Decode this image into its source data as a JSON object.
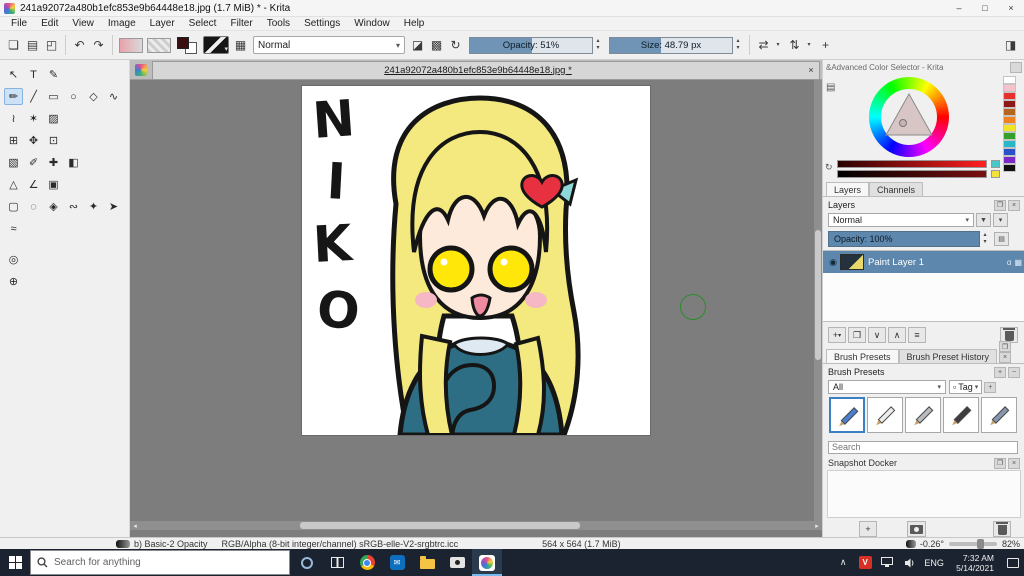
{
  "window": {
    "title": "241a92072a480b1efc853e9b64448e18.jpg (1.7 MiB) * - Krita"
  },
  "menu": {
    "items": [
      "File",
      "Edit",
      "View",
      "Image",
      "Layer",
      "Select",
      "Filter",
      "Tools",
      "Settings",
      "Window",
      "Help"
    ]
  },
  "toolbar": {
    "blend_mode": "Normal",
    "opacity_label": "Opacity: 51%",
    "size_label": "Size: 48.79 px"
  },
  "canvas": {
    "tab_title": "241a92072a480b1efc853e9b64448e18.jpg *",
    "artwork": {
      "letters": [
        "N",
        "I",
        "K",
        "O"
      ],
      "colors": {
        "hair": "#f3e97e",
        "skin": "#fdeada",
        "eyes": "#ffe70a",
        "blush": "#f5b8c4",
        "mouth": "#ef8aa0",
        "sweater": "#2e6e84",
        "heart": "#e73141",
        "bow": "#8fd8da",
        "collar": "#dfe9f2",
        "outline": "#151515"
      }
    }
  },
  "color_docker": {
    "title": "&Advanced Color Selector - Krita",
    "swatches": [
      "#ffffff",
      "#f6c2cc",
      "#e63030",
      "#8c1818",
      "#b5651d",
      "#f08020",
      "#f2e22a",
      "#33a02c",
      "#2ab8c8",
      "#2a52c8",
      "#7a2ac8",
      "#101010"
    ],
    "recent": [
      "#46c8c8",
      "#f2e23a"
    ]
  },
  "layers_docker": {
    "tab_layers": "Layers",
    "tab_channels": "Channels",
    "title": "Layers",
    "blend_mode": "Normal",
    "opacity_label": "Opacity:  100%",
    "layer_name": "Paint Layer 1"
  },
  "brush_docker": {
    "tab_presets": "Brush Presets",
    "tab_history": "Brush Preset History",
    "section_label": "Brush Presets",
    "filter_value": "All",
    "tag_label": "Tag",
    "search_placeholder": "Search",
    "preset_colors": [
      "#4a7fd0",
      "#ececec",
      "#b8bcc0",
      "#3c3c3c",
      "#8696ac"
    ]
  },
  "snapshot_docker": {
    "title": "Snapshot Docker"
  },
  "status_bar": {
    "brush_name": "b) Basic-2 Opacity",
    "color_profile": "RGB/Alpha (8-bit integer/channel)  sRGB-elle-V2-srgbtrc.icc",
    "doc_size": "564 x 564 (1.7 MiB)",
    "rotation": "-0.26°",
    "zoom": "82%"
  },
  "taskbar": {
    "search_placeholder": "Search for anything",
    "language": "ENG",
    "time": "7:32 AM",
    "date": "5/14/2021"
  },
  "colors": {
    "accent": "#5d87ac",
    "toolbar_slider_fill": "#6f94b5",
    "canvas_bg": "#7d7d7d",
    "taskbar_bg": "#1c2330",
    "brush_cursor": "#2e8b2e",
    "foreground_color": "#3a0f0f"
  },
  "icons": {
    "minimize": "–",
    "maximize": "□",
    "close": "×",
    "new": "❏",
    "open": "▤",
    "save": "◰",
    "undo": "↶",
    "redo": "↷",
    "presets": "▦",
    "eraser": "◪",
    "alpha": "▩",
    "reload": "↻",
    "mirror_h": "⇄",
    "mirror_v": "⇅",
    "origin": "+",
    "docker": "◨",
    "dropdown": "▾",
    "spin_up": "▴",
    "spin_down": "▾",
    "funnel": "▼",
    "list": "▤",
    "checkbox": "▫",
    "add": "+",
    "minus": "−",
    "mail": "✉",
    "tool_select_shapes": "↖",
    "tool_text": "T",
    "tool_edit_shapes": "✎",
    "tool_freehand": "✏",
    "tool_line": "╱",
    "tool_rect": "▭",
    "tool_ellipse": "○",
    "tool_polygon": "◇",
    "tool_polyline": "∿",
    "tool_dynamic": "≀",
    "tool_multibrush": "✶",
    "tool_pattern": "▨",
    "tool_transform": "⊞",
    "tool_move": "✥",
    "tool_crop": "⊡",
    "tool_gradient": "▧",
    "tool_sampler": "✐",
    "tool_patch": "✚",
    "tool_fill": "◧",
    "tool_assistants": "△",
    "tool_measure": "∠",
    "tool_reference": "▣",
    "tool_sel_rect": "▢",
    "tool_sel_ellipse": "◌",
    "tool_sel_poly": "◈",
    "tool_sel_free": "∾",
    "tool_sel_similar": "✦",
    "tool_sel_bezier": "➤",
    "tool_sel_magnetic": "≈",
    "tool_zoom": "◎",
    "tool_pan": "⊕",
    "tab_close": "×",
    "scroll_left": "◂",
    "scroll_right": "▸",
    "eye": "◉",
    "alpha_label": "α",
    "duplicate": "❐",
    "down": "∨",
    "up": "∧",
    "properties": "≡",
    "chevron_up": "∧",
    "vlc": "V"
  }
}
